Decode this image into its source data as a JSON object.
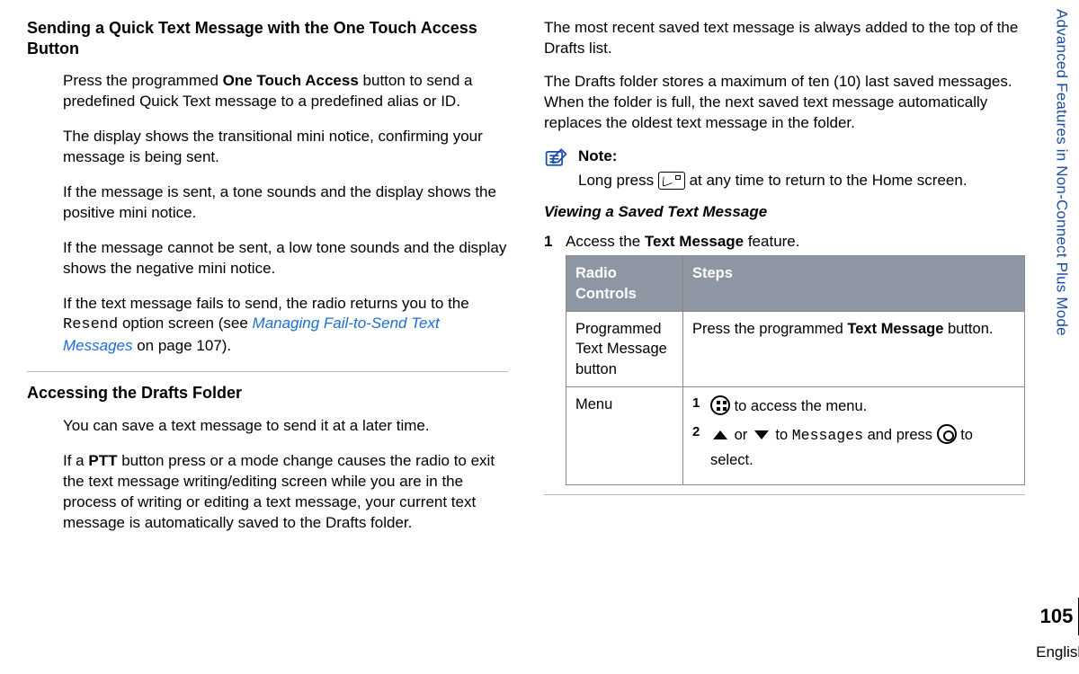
{
  "side": {
    "chapter": "Advanced Features in Non-Connect Plus Mode",
    "page_number": "105",
    "language": "English"
  },
  "col1": {
    "h_quicktext": "Sending a Quick Text Message with the One Touch Access Button",
    "qt_p1_a": "Press the programmed ",
    "qt_p1_b": "One Touch Access",
    "qt_p1_c": " button to send a predefined Quick Text message to a predefined alias or ID.",
    "qt_p2": "The display shows the transitional mini notice, confirming your message is being sent.",
    "qt_p3": "If the message is sent, a tone sounds and the display shows the positive mini notice.",
    "qt_p4": "If the message cannot be sent, a low tone sounds and the display shows the negative mini notice.",
    "qt_p5_a": "If the text message fails to send, the radio returns you to the ",
    "qt_p5_mono": "Resend",
    "qt_p5_b": " option screen (see ",
    "qt_p5_link": "Managing Fail-to-Send Text Messages",
    "qt_p5_c": " on page 107).",
    "h_drafts": "Accessing the Drafts Folder",
    "dr_p1": "You can save a text message to send it at a later time.",
    "dr_p2_a": "If a ",
    "dr_p2_b": "PTT",
    "dr_p2_c": " button press or a mode change causes the radio to exit the text message writing/editing screen while you are in the process of writing or editing a text message, your current text message is automatically saved to the Drafts folder."
  },
  "col2": {
    "top_p1": "The most recent saved text message is always added to the top of the Drafts list.",
    "top_p2": "The Drafts folder stores a maximum of ten (10) last saved messages. When the folder is full, the next saved text message automatically replaces the oldest text message in the folder.",
    "note_label": "Note:",
    "note_a": "Long press ",
    "note_b": " at any time to return to the Home screen.",
    "h_view": "Viewing a Saved Text Message",
    "step1_n": "1",
    "step1_a": "Access the ",
    "step1_b": "Text Message",
    "step1_c": " feature.",
    "th1": "Radio Controls",
    "th2": "Steps",
    "r1c1": "Programmed Text Message button",
    "r1c2_a": "Press the programmed ",
    "r1c2_b": "Text Message",
    "r1c2_c": " button.",
    "r2c1": "Menu",
    "mini1_n": "1",
    "mini1_t": " to access the menu.",
    "mini2_n": "2",
    "mini2_a": " or ",
    "mini2_b": " to ",
    "mini2_mono": "Messages",
    "mini2_c": " and press ",
    "mini2_d": " to select."
  }
}
